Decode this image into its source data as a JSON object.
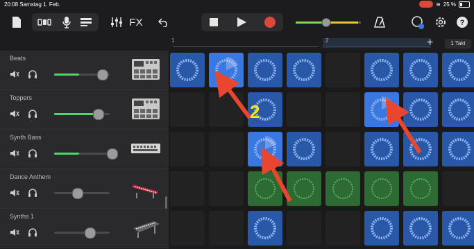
{
  "status": {
    "time_date": "20:08  Samstag 1. Feb.",
    "battery": "25 %"
  },
  "toolbar": {
    "fx_label": "FX",
    "bar_label": "1 Takt"
  },
  "ruler": {
    "marker_1": "1",
    "marker_2": "2"
  },
  "tracks": [
    {
      "name": "Beats",
      "volume": 0.85,
      "level": 0.45
    },
    {
      "name": "Toppers",
      "volume": 0.78,
      "level": 0.8
    },
    {
      "name": "Synth Bass",
      "volume": 0.97,
      "level": 0.45
    },
    {
      "name": "Dance Anthem",
      "volume": 0.4,
      "level": 0
    },
    {
      "name": "Synths 1",
      "volume": 0.62,
      "level": 0
    }
  ],
  "annotation": {
    "step": "2"
  },
  "colors": {
    "accent_blue": "#3b77e0",
    "cell_blue": "#2a58a8",
    "cell_green": "#2e6a34",
    "meter_green": "#4cd964",
    "arrow_red": "#e8462e",
    "annotation_yellow": "#ffe600"
  },
  "cells": [
    [
      "blue",
      "blue-playing",
      "blue",
      "blue",
      "empty",
      "blue",
      "blue",
      "blue"
    ],
    [
      "empty",
      "empty",
      "blue",
      "empty",
      "empty",
      "blue-playing",
      "blue",
      "blue"
    ],
    [
      "empty",
      "empty",
      "blue-playing",
      "blue",
      "empty",
      "blue",
      "blue",
      "blue"
    ],
    [
      "empty",
      "empty",
      "green",
      "green",
      "green",
      "green",
      "green",
      "empty"
    ],
    [
      "empty",
      "empty",
      "blue",
      "empty",
      "empty",
      "blue",
      "blue",
      "blue"
    ]
  ]
}
